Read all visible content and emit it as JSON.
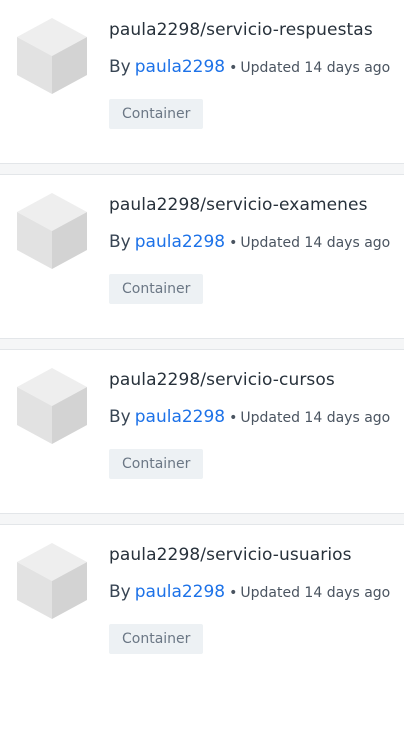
{
  "repositories": [
    {
      "name": "paula2298/servicio-respuestas",
      "by_label": "By",
      "author": "paula2298",
      "separator": "•",
      "updated": "Updated 14 days ago",
      "badge": "Container",
      "icon": "cube-icon"
    },
    {
      "name": "paula2298/servicio-examenes",
      "by_label": "By",
      "author": "paula2298",
      "separator": "•",
      "updated": "Updated 14 days ago",
      "badge": "Container",
      "icon": "cube-icon"
    },
    {
      "name": "paula2298/servicio-cursos",
      "by_label": "By",
      "author": "paula2298",
      "separator": "•",
      "updated": "Updated 14 days ago",
      "badge": "Container",
      "icon": "cube-icon"
    },
    {
      "name": "paula2298/servicio-usuarios",
      "by_label": "By",
      "author": "paula2298",
      "separator": "•",
      "updated": "Updated 14 days ago",
      "badge": "Container",
      "icon": "cube-icon"
    }
  ],
  "colors": {
    "link": "#1d72e8",
    "title": "#27313b",
    "badge_bg": "#edf1f4",
    "badge_text": "#6b7785",
    "separator_bg": "#f5f6f7"
  }
}
